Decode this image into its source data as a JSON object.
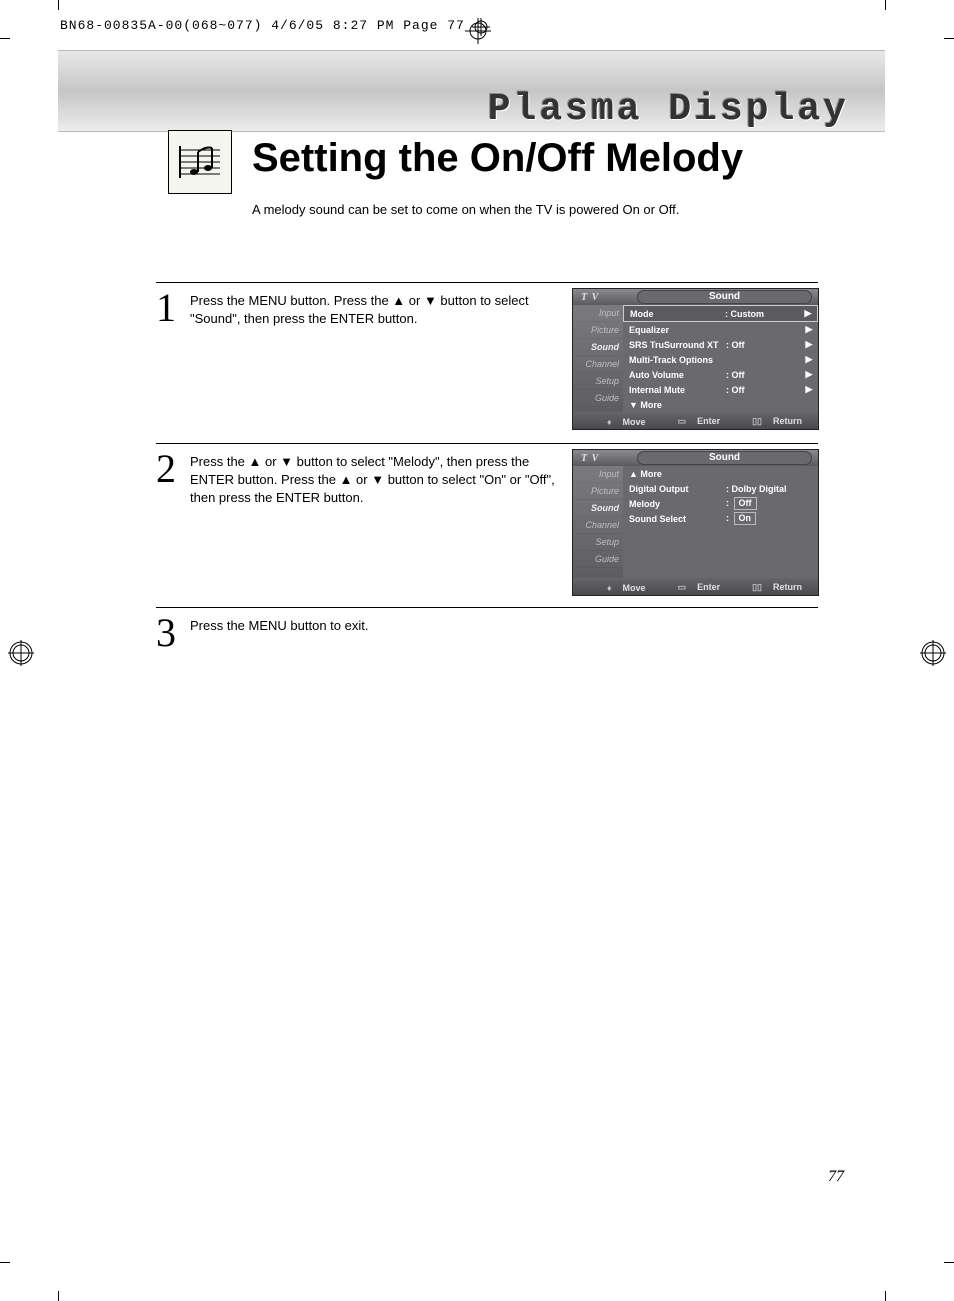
{
  "printers_slug": "BN68-00835A-00(068~077)  4/6/05  8:27 PM  Page 77",
  "banner_title": "Plasma Display",
  "page_title": "Setting the On/Off Melody",
  "intro": "A melody sound can be set to come on when the TV is powered On or Off.",
  "steps": [
    {
      "num": "1",
      "text": "Press the MENU button. Press the ▲ or ▼ button to select \"Sound\", then press the ENTER button."
    },
    {
      "num": "2",
      "text": "Press the ▲ or ▼ button to select \"Melody\", then press the ENTER button. Press the ▲ or ▼ button to select \"On\" or \"Off\", then press the ENTER button."
    },
    {
      "num": "3",
      "text": "Press the MENU button to exit."
    }
  ],
  "osd_common": {
    "tv": "T V",
    "title": "Sound",
    "tabs": [
      "Input",
      "Picture",
      "Sound",
      "Channel",
      "Setup",
      "Guide"
    ],
    "footer": {
      "move": "Move",
      "enter": "Enter",
      "return": "Return"
    }
  },
  "osd1_rows": [
    {
      "label": "Mode",
      "value": ": Custom",
      "caret": "▶",
      "selected": true
    },
    {
      "label": "Equalizer",
      "value": "",
      "caret": "▶"
    },
    {
      "label": "SRS TruSurround XT",
      "value": ": Off",
      "caret": "▶"
    },
    {
      "label": "Multi-Track Options",
      "value": "",
      "caret": "▶"
    },
    {
      "label": "Auto Volume",
      "value": ": Off",
      "caret": "▶"
    },
    {
      "label": "Internal Mute",
      "value": ": Off",
      "caret": "▶"
    },
    {
      "label": "▼ More",
      "value": "",
      "caret": ""
    }
  ],
  "osd2_rows": [
    {
      "label": "▲ More",
      "value": "",
      "caret": ""
    },
    {
      "label": "Digital Output",
      "value": ": Dolby Digital",
      "caret": ""
    },
    {
      "label": "Melody",
      "value_prefix": ": ",
      "value_box": "Off",
      "caret": ""
    },
    {
      "label": "Sound Select",
      "value_prefix": ": ",
      "value_box": "On",
      "caret": ""
    }
  ],
  "page_number": "77"
}
